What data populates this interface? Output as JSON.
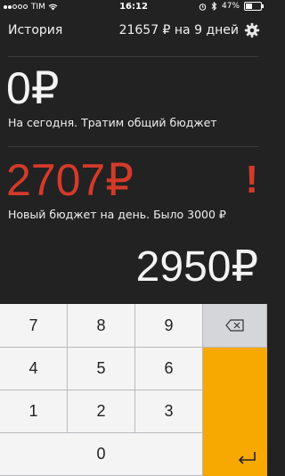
{
  "status": {
    "carrier": "TIM",
    "time": "16:12",
    "battery": "47%",
    "battery_level": 0.47
  },
  "header": {
    "history_label": "История",
    "summary": "21657 ₽ на 9 дней"
  },
  "today": {
    "amount": "0₽",
    "caption": "На сегодня. Тратим общий бюджет"
  },
  "budget": {
    "amount": "2707₽",
    "alert": "!",
    "caption": "Новый бюджет на день. Было 3000 ₽"
  },
  "input": {
    "value": "2950₽"
  },
  "keypad": {
    "keys": [
      "7",
      "8",
      "9",
      "4",
      "5",
      "6",
      "1",
      "2",
      "3",
      "0"
    ]
  },
  "colors": {
    "accent_red": "#d43a2a",
    "enter": "#f7a801",
    "background": "#222222"
  }
}
